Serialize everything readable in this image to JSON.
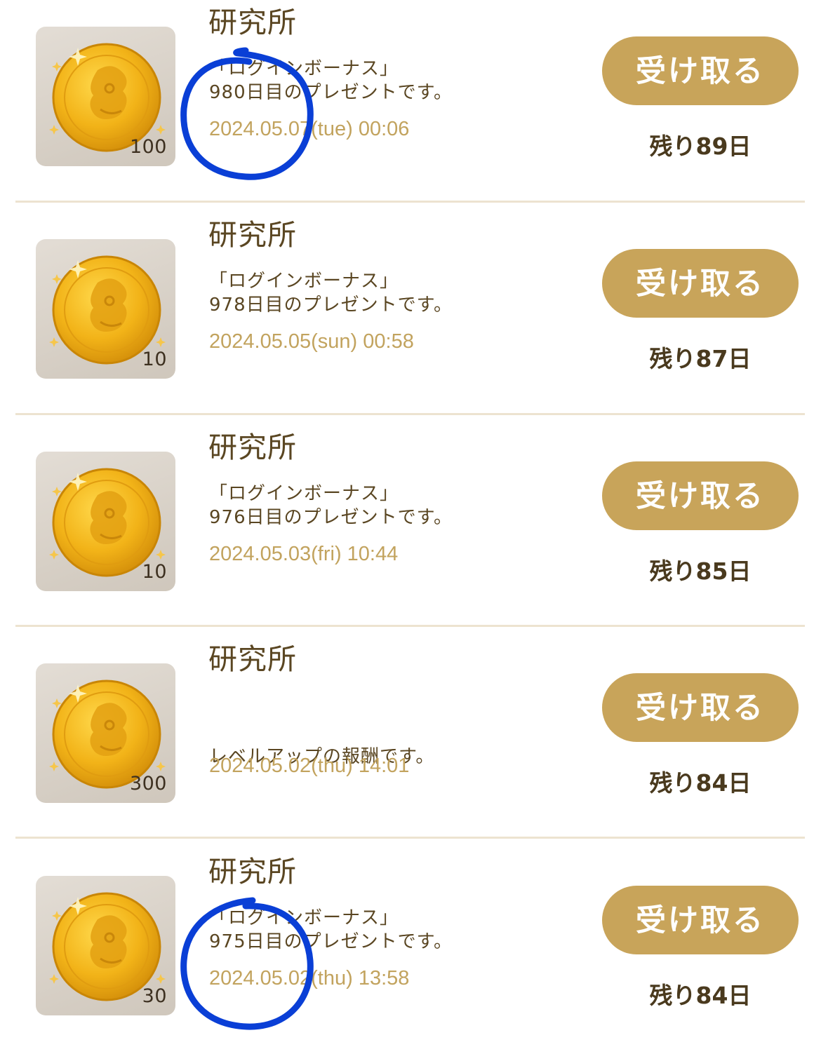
{
  "colors": {
    "accent_gold": "#c8a45a",
    "date_text": "#c2a35e",
    "primary_text": "#5a4622",
    "annotation_blue": "#0a3fd6"
  },
  "items": [
    {
      "sender": "研究所",
      "message": "「ログインボーナス」\n980日目のプレゼントです。",
      "date": "2024.05.07(tue) 00:06",
      "quantity": "100",
      "icon": "gold-coin-icon",
      "button_label": "受け取る",
      "remaining": "残り89日"
    },
    {
      "sender": "研究所",
      "message": "「ログインボーナス」\n978日目のプレゼントです。",
      "date": "2024.05.05(sun) 00:58",
      "quantity": "10",
      "icon": "gold-coin-icon",
      "button_label": "受け取る",
      "remaining": "残り87日"
    },
    {
      "sender": "研究所",
      "message": "「ログインボーナス」\n976日目のプレゼントです。",
      "date": "2024.05.03(fri) 10:44",
      "quantity": "10",
      "icon": "gold-coin-icon",
      "button_label": "受け取る",
      "remaining": "残り85日"
    },
    {
      "sender": "研究所",
      "message": "レベルアップの報酬です。",
      "date": "2024.05.02(thu) 14:01",
      "quantity": "300",
      "icon": "gold-coin-icon",
      "button_label": "受け取る",
      "remaining": "残り84日"
    },
    {
      "sender": "研究所",
      "message": "「ログインボーナス」\n975日目のプレゼントです。",
      "date": "2024.05.02(thu) 13:58",
      "quantity": "30",
      "icon": "gold-coin-icon",
      "button_label": "受け取る",
      "remaining": "残り84日"
    }
  ]
}
